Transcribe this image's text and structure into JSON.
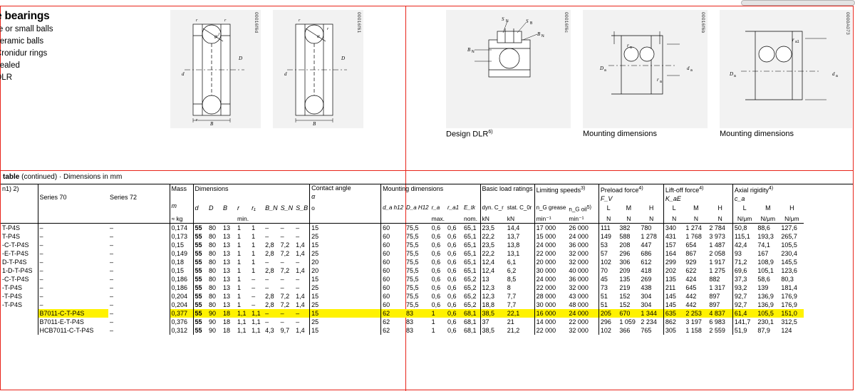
{
  "header": {
    "title": "e bearings",
    "sub_lines": [
      "re or small balls",
      "ceramic balls",
      "Cronidur rings",
      "sealed",
      "DLR"
    ]
  },
  "figures": [
    {
      "code": "00016f6d",
      "caption": ""
    },
    {
      "code": "00016f61",
      "caption": ""
    },
    {
      "code": "00016f6c",
      "caption": "Design DLR",
      "caption_sup": "6)"
    },
    {
      "code": "00016f6b",
      "caption": "Mounting dimensions",
      "caption_sup": ""
    },
    {
      "code": "0000A073",
      "caption": "Mounting dimensions",
      "caption_sup": ""
    }
  ],
  "table_caption": {
    "bold": "table",
    "rest": "(continued) · Dimensions in mm"
  },
  "columns": {
    "designation_note": "n1) 2)",
    "series70": "Series 70",
    "series72": "Series 72",
    "mass": "Mass",
    "mass_sym": "m",
    "mass_unit": "≈ kg",
    "dimensions": "Dimensions",
    "dims": [
      "d",
      "D",
      "B",
      "r",
      "r₁",
      "B_N",
      "S_N",
      "S_B"
    ],
    "dims_min": "min.",
    "contact_angle": "Contact angle",
    "contact_angle_sym": "α",
    "contact_angle_unit": "o",
    "mounting_dimensions": "Mounting dimensions",
    "mount": [
      "d_a h12",
      "D_a H12",
      "r_a",
      "r_a1",
      "E_tk"
    ],
    "mount_max": "max.",
    "mount_nom": "nom.",
    "basic_load": "Basic load ratings",
    "load_dyn": "dyn. C_r",
    "load_stat": "stat. C_0r",
    "load_unit": "kN",
    "limiting_speeds": "Limiting speeds",
    "limiting_speeds_sup": "3)",
    "ng_grease": "n_G grease",
    "ng_oil": "n_G oil",
    "ng_oil_sup": "5)",
    "speed_unit": "min⁻¹",
    "preload_force": "Preload force",
    "preload_force_sup": "4)",
    "preload_sym": "F_V",
    "preload_cols": [
      "L",
      "M",
      "H"
    ],
    "preload_unit": "N",
    "liftoff": "Lift-off force",
    "liftoff_sup": "4)",
    "liftoff_sym": "K_aE",
    "liftoff_cols": [
      "L",
      "M",
      "H"
    ],
    "liftoff_unit": "N",
    "axial_rigidity": "Axial rigidity",
    "axial_rigidity_sup": "4)",
    "axial_sym": "c_a",
    "axial_cols": [
      "L",
      "M",
      "H"
    ],
    "axial_unit": "N/μm"
  },
  "rows": [
    {
      "d1": "T-P4S",
      "s70": "–",
      "s72": "–",
      "m": "0,174",
      "d": "55",
      "D": "80",
      "B": "13",
      "r": "1",
      "r1": "1",
      "bn": "–",
      "sn": "–",
      "sb": "–",
      "alpha": "15",
      "da": "60",
      "Da": "75,5",
      "ra": "0,6",
      "ra1": "0,6",
      "etk": "65,1",
      "cr": "23,5",
      "c0r": "14,4",
      "ngg": "17 000",
      "ngo": "26 000",
      "pl": "111",
      "pm": "382",
      "ph": "780",
      "ll": "340",
      "lm": "1 274",
      "lh": "2 784",
      "al": "50,8",
      "am": "88,6",
      "ah": "127,6",
      "hl": false
    },
    {
      "d1": "T-P4S",
      "s70": "–",
      "s72": "–",
      "m": "0,173",
      "d": "55",
      "D": "80",
      "B": "13",
      "r": "1",
      "r1": "1",
      "bn": "–",
      "sn": "–",
      "sb": "–",
      "alpha": "25",
      "da": "60",
      "Da": "75,5",
      "ra": "0,6",
      "ra1": "0,6",
      "etk": "65,1",
      "cr": "22,2",
      "c0r": "13,7",
      "ngg": "15 000",
      "ngo": "24 000",
      "pl": "149",
      "pm": "588",
      "ph": "1 278",
      "ll": "431",
      "lm": "1 768",
      "lh": "3 973",
      "al": "115,1",
      "am": "193,3",
      "ah": "265,7",
      "hl": false
    },
    {
      "d1": "-C-T-P4S",
      "s70": "–",
      "s72": "–",
      "m": "0,15",
      "d": "55",
      "D": "80",
      "B": "13",
      "r": "1",
      "r1": "1",
      "bn": "2,8",
      "sn": "7,2",
      "sb": "1,4",
      "alpha": "15",
      "da": "60",
      "Da": "75,5",
      "ra": "0,6",
      "ra1": "0,6",
      "etk": "65,1",
      "cr": "23,5",
      "c0r": "13,8",
      "ngg": "24 000",
      "ngo": "36 000",
      "pl": "53",
      "pm": "208",
      "ph": "447",
      "ll": "157",
      "lm": "654",
      "lh": "1 487",
      "al": "42,4",
      "am": "74,1",
      "ah": "105,5",
      "hl": false
    },
    {
      "d1": "-E-T-P4S",
      "s70": "–",
      "s72": "–",
      "m": "0,149",
      "d": "55",
      "D": "80",
      "B": "13",
      "r": "1",
      "r1": "1",
      "bn": "2,8",
      "sn": "7,2",
      "sb": "1,4",
      "alpha": "25",
      "da": "60",
      "Da": "75,5",
      "ra": "0,6",
      "ra1": "0,6",
      "etk": "65,1",
      "cr": "22,2",
      "c0r": "13,1",
      "ngg": "22 000",
      "ngo": "32 000",
      "pl": "57",
      "pm": "296",
      "ph": "686",
      "ll": "164",
      "lm": "867",
      "lh": "2 058",
      "al": "93",
      "am": "167",
      "ah": "230,4",
      "hl": false
    },
    {
      "d1": "D-T-P4S",
      "s70": "–",
      "s72": "–",
      "m": "0,18",
      "d": "55",
      "D": "80",
      "B": "13",
      "r": "1",
      "r1": "1",
      "bn": "–",
      "sn": "–",
      "sb": "–",
      "alpha": "20",
      "da": "60",
      "Da": "75,5",
      "ra": "0,6",
      "ra1": "0,6",
      "etk": "65,1",
      "cr": "12,4",
      "c0r": "6,1",
      "ngg": "20 000",
      "ngo": "32 000",
      "pl": "102",
      "pm": "306",
      "ph": "612",
      "ll": "299",
      "lm": "929",
      "lh": "1 917",
      "al": "71,2",
      "am": "108,9",
      "ah": "145,5",
      "hl": false
    },
    {
      "d1": "1-D-T-P4S",
      "s70": "–",
      "s72": "–",
      "m": "0,15",
      "d": "55",
      "D": "80",
      "B": "13",
      "r": "1",
      "r1": "1",
      "bn": "2,8",
      "sn": "7,2",
      "sb": "1,4",
      "alpha": "20",
      "da": "60",
      "Da": "75,5",
      "ra": "0,6",
      "ra1": "0,6",
      "etk": "65,1",
      "cr": "12,4",
      "c0r": "6,2",
      "ngg": "30 000",
      "ngo": "40 000",
      "pl": "70",
      "pm": "209",
      "ph": "418",
      "ll": "202",
      "lm": "622",
      "lh": "1 275",
      "al": "69,6",
      "am": "105,1",
      "ah": "123,6",
      "hl": false
    },
    {
      "d1": "-C-T-P4S",
      "s70": "–",
      "s72": "–",
      "m": "0,186",
      "d": "55",
      "D": "80",
      "B": "13",
      "r": "1",
      "r1": "–",
      "bn": "–",
      "sn": "–",
      "sb": "–",
      "alpha": "15",
      "da": "60",
      "Da": "75,5",
      "ra": "0,6",
      "ra1": "0,6",
      "etk": "65,2",
      "cr": "13",
      "c0r": "8,5",
      "ngg": "24 000",
      "ngo": "36 000",
      "pl": "45",
      "pm": "135",
      "ph": "269",
      "ll": "135",
      "lm": "424",
      "lh": "882",
      "al": "37,3",
      "am": "58,6",
      "ah": "80,3",
      "hl": false
    },
    {
      "d1": "-T-P4S",
      "s70": "–",
      "s72": "–",
      "m": "0,186",
      "d": "55",
      "D": "80",
      "B": "13",
      "r": "1",
      "r1": "–",
      "bn": "–",
      "sn": "–",
      "sb": "–",
      "alpha": "25",
      "da": "60",
      "Da": "75,5",
      "ra": "0,6",
      "ra1": "0,6",
      "etk": "65,2",
      "cr": "12,3",
      "c0r": "8",
      "ngg": "22 000",
      "ngo": "32 000",
      "pl": "73",
      "pm": "219",
      "ph": "438",
      "ll": "211",
      "lm": "645",
      "lh": "1 317",
      "al": "93,2",
      "am": "139",
      "ah": "181,4",
      "hl": false
    },
    {
      "d1": "-T-P4S",
      "s70": "–",
      "s72": "–",
      "m": "0,204",
      "d": "55",
      "D": "80",
      "B": "13",
      "r": "1",
      "r1": "–",
      "bn": "2,8",
      "sn": "7,2",
      "sb": "1,4",
      "alpha": "15",
      "da": "60",
      "Da": "75,5",
      "ra": "0,6",
      "ra1": "0,6",
      "etk": "65,2",
      "cr": "12,3",
      "c0r": "7,7",
      "ngg": "28 000",
      "ngo": "43 000",
      "pl": "51",
      "pm": "152",
      "ph": "304",
      "ll": "145",
      "lm": "442",
      "lh": "897",
      "al": "92,7",
      "am": "136,9",
      "ah": "176,9",
      "hl": false
    },
    {
      "d1": "-T-P4S",
      "s70": "–",
      "s72": "–",
      "m": "0,204",
      "d": "55",
      "D": "80",
      "B": "13",
      "r": "1",
      "r1": "–",
      "bn": "2,8",
      "sn": "7,2",
      "sb": "1,4",
      "alpha": "25",
      "da": "60",
      "Da": "75,5",
      "ra": "0,6",
      "ra1": "0,6",
      "etk": "65,2",
      "cr": "18,8",
      "c0r": "7,7",
      "ngg": "30 000",
      "ngo": "48 000",
      "pl": "51",
      "pm": "152",
      "ph": "304",
      "ll": "145",
      "lm": "442",
      "lh": "897",
      "al": "92,7",
      "am": "136,9",
      "ah": "176,9",
      "hl": false
    },
    {
      "d1": "",
      "s70": "B7011-C-T-P4S",
      "s72": "–",
      "m": "0,377",
      "d": "55",
      "D": "90",
      "B": "18",
      "r": "1,1",
      "r1": "1,1",
      "bn": "–",
      "sn": "–",
      "sb": "–",
      "alpha": "15",
      "da": "62",
      "Da": "83",
      "ra": "1",
      "ra1": "0,6",
      "etk": "68,1",
      "cr": "38,5",
      "c0r": "22,1",
      "ngg": "16 000",
      "ngo": "24 000",
      "pl": "205",
      "pm": "670",
      "ph": "1 344",
      "ll": "635",
      "lm": "2 253",
      "lh": "4 837",
      "al": "61,4",
      "am": "105,5",
      "ah": "151,0",
      "hl": true
    },
    {
      "d1": "",
      "s70": "B7011-E-T-P4S",
      "s72": "–",
      "m": "0,376",
      "d": "55",
      "D": "90",
      "B": "18",
      "r": "1,1",
      "r1": "1,1",
      "bn": "–",
      "sn": "–",
      "sb": "–",
      "alpha": "25",
      "da": "62",
      "Da": "83",
      "ra": "1",
      "ra1": "0,6",
      "etk": "68,1",
      "cr": "37",
      "c0r": "21",
      "ngg": "14 000",
      "ngo": "22 000",
      "pl": "296",
      "pm": "1 059",
      "ph": "2 234",
      "ll": "862",
      "lm": "3 197",
      "lh": "6 983",
      "al": "141,7",
      "am": "230,1",
      "ah": "312,5",
      "hl": false
    },
    {
      "d1": "",
      "s70": "HCB7011-C-T-P4S",
      "s72": "–",
      "m": "0,312",
      "d": "55",
      "D": "90",
      "B": "18",
      "r": "1,1",
      "r1": "1,1",
      "bn": "4,3",
      "sn": "9,7",
      "sb": "1,4",
      "alpha": "15",
      "da": "62",
      "Da": "83",
      "ra": "1",
      "ra1": "0,6",
      "etk": "68,1",
      "cr": "38,5",
      "c0r": "21,2",
      "ngg": "22 000",
      "ngo": "32 000",
      "pl": "102",
      "pm": "366",
      "ph": "765",
      "ll": "305",
      "lm": "1 158",
      "lh": "2 559",
      "al": "51,9",
      "am": "87,9",
      "ah": "124",
      "hl": false
    }
  ]
}
